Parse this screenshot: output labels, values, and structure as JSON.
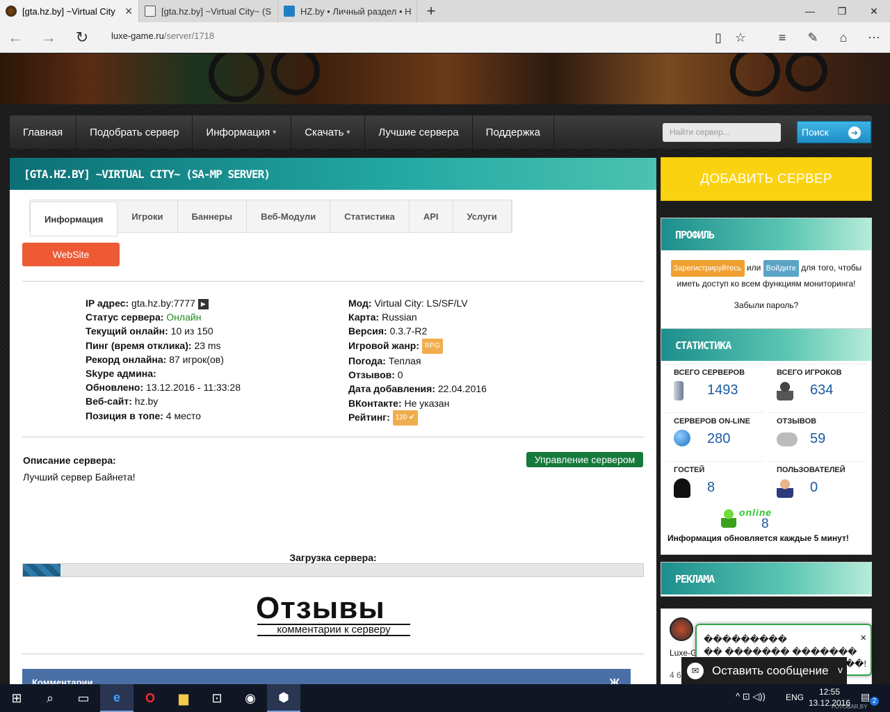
{
  "browser": {
    "tabs": [
      {
        "title": "[gta.hz.by] ~Virtual City",
        "active": true
      },
      {
        "title": "[gta.hz.by] ~Virtual City~ (S",
        "active": false
      },
      {
        "title": "HZ.by • Личный раздел • Н",
        "active": false
      }
    ],
    "new_tab": "+",
    "url_host": "luxe-game.ru",
    "url_path": "/server/1718",
    "win_min": "—",
    "win_max": "❐",
    "win_close": "✕"
  },
  "menu": {
    "items": [
      "Главная",
      "Подобрать сервер",
      "Информация",
      "Скачать",
      "Лучшие сервера",
      "Поддержка"
    ],
    "search_placeholder": "Найти сервер...",
    "search_button": "Поиск"
  },
  "server": {
    "title": "[GTA.HZ.BY] ~VIRTUAL CITY~ (SA-MP SERVER)",
    "tabs": [
      "Информация",
      "Игроки",
      "Баннеры",
      "Веб-Модули",
      "Статистика",
      "API",
      "Услуги"
    ],
    "website_button": "WebSite",
    "left": [
      {
        "k": "IP адрес:",
        "v": "gta.hz.by:7777"
      },
      {
        "k": "Статус сервера:",
        "v": "Онлайн"
      },
      {
        "k": "Текущий онлайн:",
        "v": "10 из 150"
      },
      {
        "k": "Пинг (время отклика):",
        "v": "23 ms"
      },
      {
        "k": "Рекорд онлайна:",
        "v": "87 игрок(ов)"
      },
      {
        "k": "Skype админа:",
        "v": ""
      },
      {
        "k": "Обновлено:",
        "v": "13.12.2016 - 11:33:28"
      },
      {
        "k": "Веб-сайт:",
        "v": "hz.by"
      },
      {
        "k": "Позиция в топе:",
        "v": "4 место"
      }
    ],
    "right": [
      {
        "k": "Мод:",
        "v": "Virtual City: LS/SF/LV"
      },
      {
        "k": "Карта:",
        "v": "Russian"
      },
      {
        "k": "Версия:",
        "v": "0.3.7-R2"
      },
      {
        "k": "Игровой жанр:",
        "v": "RPG"
      },
      {
        "k": "Погода:",
        "v": "Теплая"
      },
      {
        "k": "Отзывов:",
        "v": "0"
      },
      {
        "k": "Дата добавления:",
        "v": "22.04.2016"
      },
      {
        "k": "ВКонтакте:",
        "v": "Не указан"
      },
      {
        "k": "Рейтинг:",
        "v": "120 ✔"
      }
    ],
    "description_label": "Описание сервера:",
    "description": "Лучший сервер Байнета!",
    "manage_button": "Управление сервером",
    "load_label": "Загрузка сервера:",
    "load_fraction": 0.06,
    "reviews_big": "Отзывы",
    "reviews_sub": "комментарии к серверу",
    "comments_label": "Комментарии",
    "comments_icon_text": "Ж"
  },
  "sidebar": {
    "add_server": "ДОБАВИТЬ СЕРВЕР",
    "profile_title": "ПРОФИЛЬ",
    "register": "Зарегистрируйтесь",
    "or": "или",
    "login": "Войдите",
    "profile_text1": "для того, чтобы",
    "profile_text2": "иметь доступ ко всем функциям мониторинга!",
    "forgot": "Забыли пароль?",
    "stats_title": "СТАТИСТИКА",
    "stats": [
      {
        "label": "ВСЕГО СЕРВЕРОВ",
        "value": "1493"
      },
      {
        "label": "ВСЕГО ИГРОКОВ",
        "value": "634"
      },
      {
        "label": "СЕРВЕРОВ ON-LINE",
        "value": "280"
      },
      {
        "label": "ОТЗЫВОВ",
        "value": "59"
      },
      {
        "label": "ГОСТЕЙ",
        "value": "8"
      },
      {
        "label": "ПОЛЬЗОВАТЕЛЕЙ",
        "value": "0"
      }
    ],
    "online_word": "online",
    "online_value": "8",
    "update_note": "Информация обновляется каждые 5 минут!",
    "ads_title": "РЕКЛАМА",
    "ad_name": "Luxe-G",
    "ad_num": "4 6"
  },
  "chat": {
    "line1": "���������",
    "line2": "�� ������� �������",
    "line3": "���!",
    "close": "×",
    "bar": "Оставить сообщение",
    "bar_arrow": "v"
  },
  "taskbar": {
    "lang": "ENG",
    "time": "12:55",
    "date": "13.12.2016",
    "notif": "2",
    "watermark": "FOTOBAR.BY"
  },
  "colors": {
    "teal": "#1c8e8c",
    "add_yellow": "#fbd20f",
    "website_orange": "#ed5a34",
    "manage_green": "#167a3c",
    "online_green": "#1a8a1a",
    "link_blue": "#1b5aa0"
  }
}
